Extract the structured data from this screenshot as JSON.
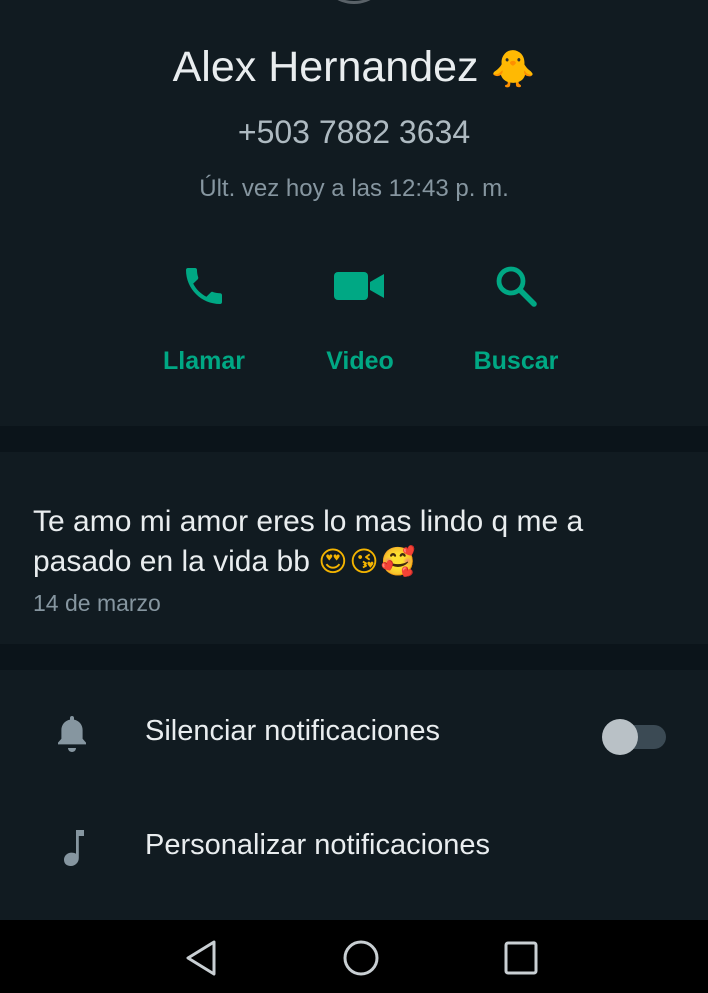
{
  "contact": {
    "name": "Alex Hernandez",
    "name_emoji": "🐥",
    "phone": "+503 7882 3634",
    "last_seen": "Últ. vez hoy a las 12:43 p. m."
  },
  "actions": [
    {
      "label": "Llamar",
      "icon": "phone-icon"
    },
    {
      "label": "Video",
      "icon": "video-camera-icon"
    },
    {
      "label": "Buscar",
      "icon": "search-icon"
    }
  ],
  "about": {
    "text": "Te amo mi amor eres lo mas lindo q me a pasado en la vida bb",
    "emojis": "😍😘🥰",
    "date": "14 de marzo"
  },
  "settings": {
    "mute_label": "Silenciar notificaciones",
    "mute_enabled": false,
    "custom_label": "Personalizar notificaciones"
  },
  "navbar": {
    "back_icon": "back-triangle-icon",
    "home_icon": "home-circle-icon",
    "recents_icon": "recents-square-icon"
  },
  "colors": {
    "background": "#111b21",
    "divider": "#0b141a",
    "accent": "#00a884",
    "primary_text": "#e9edef",
    "secondary_text": "#8696a0"
  }
}
